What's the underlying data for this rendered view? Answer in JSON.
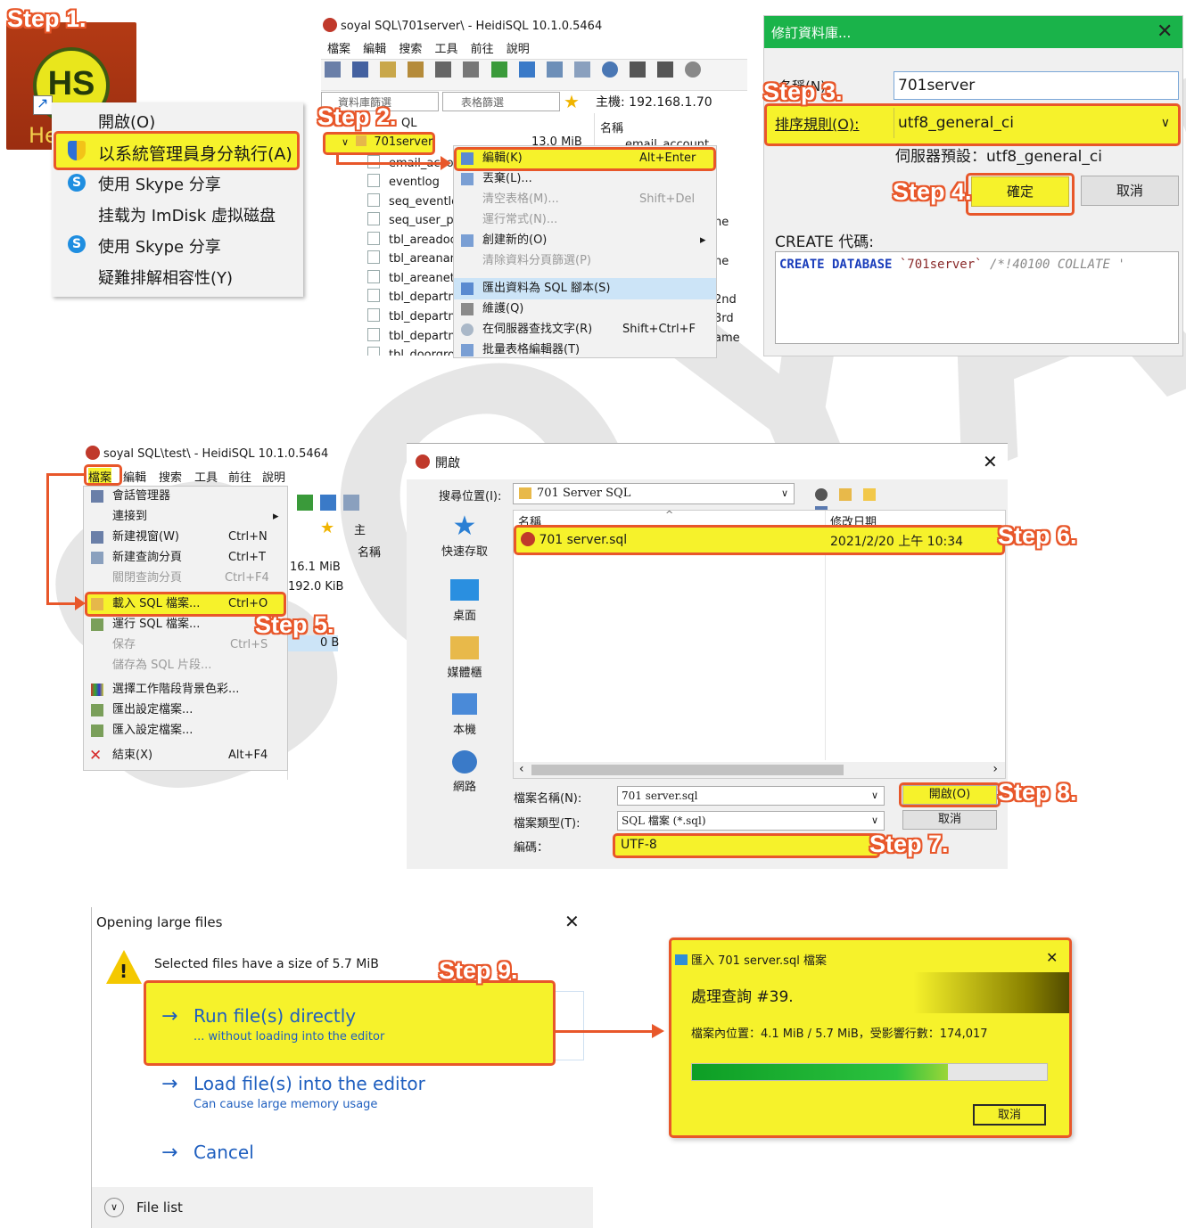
{
  "watermark": "SOYAL",
  "steps": {
    "s1": "Step 1.",
    "s2": "Step 2.",
    "s3": "Step 3.",
    "s4": "Step 4.",
    "s5": "Step 5.",
    "s6": "Step 6.",
    "s7": "Step 7.",
    "s8": "Step 8.",
    "s9": "Step 9."
  },
  "panel1": {
    "icon_text": "HS",
    "icon_caption": "He",
    "menu": [
      {
        "label": "開啟(O)"
      },
      {
        "label": "以系統管理員身分執行(A)"
      },
      {
        "label": "使用 Skype 分享"
      },
      {
        "label": "挂载为 ImDisk 虚拟磁盘"
      },
      {
        "label": "使用 Skype 分享"
      },
      {
        "label": "疑難排解相容性(Y)"
      }
    ]
  },
  "panel2": {
    "title": "soyal SQL\\701server\\ - HeidiSQL 10.1.0.5464",
    "menubar": [
      "檔案",
      "編輯",
      "搜索",
      "工具",
      "前往",
      "說明"
    ],
    "filter_db": "資料庫篩選",
    "filter_table": "表格篩選",
    "host": "主機: 192.168.1.70",
    "tree_root_suffix": "QL",
    "selected_db": "701server",
    "selected_size": "13.0 MiB",
    "tables": [
      "email_acco",
      "eventlog",
      "seq_eventlo",
      "seq_user_pi",
      "tbl_areadoc",
      "tbl_areanam",
      "tbl_areaneti",
      "tbl_departm",
      "tbl_departm",
      "tbl_departm",
      "tbl_doorgro"
    ],
    "col_header": "名稱",
    "right_rows": [
      "email_account",
      "ne",
      "ne",
      "2nd",
      "3rd",
      "ame"
    ],
    "context": [
      {
        "label": "編輯(K)",
        "shortcut": "Alt+Enter"
      },
      {
        "label": "丟棄(L)...",
        "shortcut": ""
      },
      {
        "label": "清空表格(M)...",
        "shortcut": "Shift+Del"
      },
      {
        "label": "運行常式(N)...",
        "shortcut": ""
      },
      {
        "label": "創建新的(O)",
        "shortcut": ""
      },
      {
        "label": "清除資料分頁篩選(P)",
        "shortcut": ""
      },
      {
        "label": "匯出資料為 SQL 腳本(S)",
        "shortcut": ""
      },
      {
        "label": "維護(Q)",
        "shortcut": ""
      },
      {
        "label": "在伺服器查找文字(R)",
        "shortcut": "Shift+Ctrl+F"
      },
      {
        "label": "批量表格編輯器(T)",
        "shortcut": ""
      }
    ]
  },
  "panel3": {
    "title": "修訂資料庫...",
    "name_label": "名稱(N):",
    "name_value": "701server",
    "collation_label": "排序規則(O):",
    "collation_value": "utf8_general_ci",
    "server_default": "伺服器預設：utf8_general_ci",
    "ok": "確定",
    "cancel": "取消",
    "create_label": "CREATE 代碼:",
    "code_kw": "CREATE DATABASE",
    "code_name": "`701server`",
    "code_comment": "/*!40100 COLLATE '"
  },
  "panel4": {
    "title": "soyal SQL\\test\\ - HeidiSQL 10.1.0.5464",
    "menubar": [
      "檔案",
      "編輯",
      "搜索",
      "工具",
      "前往",
      "說明"
    ],
    "items": [
      {
        "label": "會話管理器",
        "shortcut": ""
      },
      {
        "label": "連接到",
        "shortcut": ""
      },
      {
        "label": "新建視窗(W)",
        "shortcut": "Ctrl+N"
      },
      {
        "label": "新建查詢分頁",
        "shortcut": "Ctrl+T"
      },
      {
        "label": "關閉查詢分頁",
        "shortcut": "Ctrl+F4"
      },
      {
        "label": "載入 SQL 檔案...",
        "shortcut": "Ctrl+O"
      },
      {
        "label": "運行 SQL 檔案...",
        "shortcut": ""
      },
      {
        "label": "保存",
        "shortcut": "Ctrl+S"
      },
      {
        "label": "儲存為 SQL 片段...",
        "shortcut": ""
      },
      {
        "label": "選擇工作階段背景色彩...",
        "shortcut": ""
      },
      {
        "label": "匯出設定檔案...",
        "shortcut": ""
      },
      {
        "label": "匯入設定檔案...",
        "shortcut": ""
      },
      {
        "label": "結束(X)",
        "shortcut": "Alt+F4"
      }
    ],
    "side_host": "主",
    "side_name": "名稱",
    "sizes": [
      "16.1 MiB",
      "192.0 KiB",
      "0 B"
    ]
  },
  "panel5": {
    "title": "開啟",
    "lookin_label": "搜尋位置(I):",
    "lookin_value": "701 Server SQL",
    "col_name": "名稱",
    "col_date": "修改日期",
    "file_name": "701 server.sql",
    "file_date": "2021/2/20 上午 10:34",
    "places": [
      "快速存取",
      "桌面",
      "媒體櫃",
      "本機",
      "網路"
    ],
    "filename_label": "檔案名稱(N):",
    "filename_value": "701 server.sql",
    "filetype_label": "檔案類型(T):",
    "filetype_value": "SQL 檔案 (*.sql)",
    "encoding_label": "編碼：",
    "encoding_value": "UTF-8",
    "open_btn": "開啟(O)",
    "cancel_btn": "取消"
  },
  "panel6": {
    "title": "Opening large files",
    "message": "Selected files have a size of 5.7 MiB",
    "opt1_title": "Run file(s) directly",
    "opt1_sub": "... without loading into the editor",
    "opt2_title": "Load file(s) into the editor",
    "opt2_sub": "Can cause large memory usage",
    "opt3_title": "Cancel",
    "file_list": "File list"
  },
  "panel7": {
    "title": "匯入 701 server.sql 檔案",
    "status": "處理查詢 #39.",
    "progress_text": "檔案內位置：4.1 MiB / 5.7 MiB，受影響行數：174,017",
    "progress_value": 0.72,
    "cancel": "取消"
  },
  "colors": {
    "accent": "#e8572a",
    "highlight": "#f6f22b",
    "progress": "#1fb32d"
  }
}
